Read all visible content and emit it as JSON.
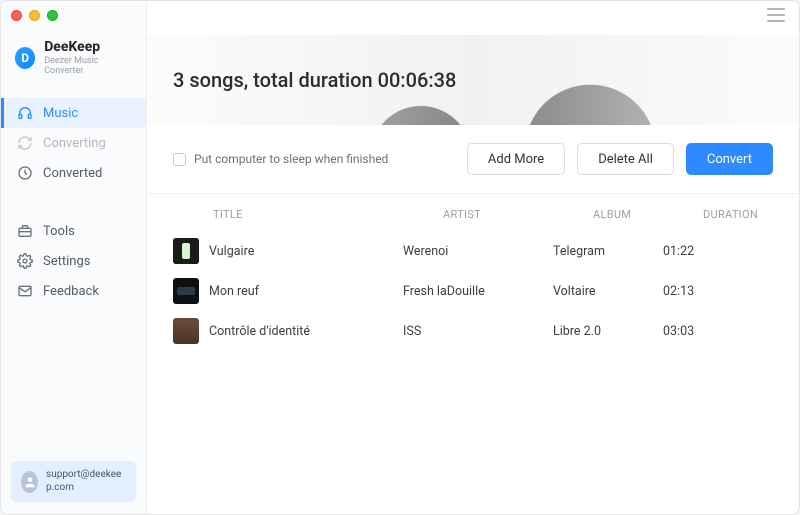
{
  "app": {
    "name": "DeeKeep",
    "subtitle": "Deezer Music Converter"
  },
  "sidebar": {
    "items": [
      {
        "label": "Music",
        "icon": "headphones-icon",
        "active": true,
        "disabled": false
      },
      {
        "label": "Converting",
        "icon": "refresh-icon",
        "active": false,
        "disabled": true
      },
      {
        "label": "Converted",
        "icon": "clock-icon",
        "active": false,
        "disabled": false
      }
    ],
    "items2": [
      {
        "label": "Tools",
        "icon": "toolbox-icon"
      },
      {
        "label": "Settings",
        "icon": "gear-icon"
      },
      {
        "label": "Feedback",
        "icon": "mail-icon"
      }
    ]
  },
  "support": {
    "email": "support@deekeep.com"
  },
  "header": {
    "title": "3 songs, total duration 00:06:38"
  },
  "toolbar": {
    "sleep_label": "Put computer to sleep when finished",
    "add_more": "Add More",
    "delete_all": "Delete All",
    "convert": "Convert"
  },
  "table": {
    "columns": {
      "title": "TITLE",
      "artist": "ARTIST",
      "album": "ALBUM",
      "duration": "DURATION"
    },
    "rows": [
      {
        "title": "Vulgaire",
        "artist": "Werenoi",
        "album": "Telegram",
        "duration": "01:22"
      },
      {
        "title": "Mon reuf",
        "artist": "Fresh laDouille",
        "album": "Voltaire",
        "duration": "02:13"
      },
      {
        "title": "Contrôle d'identité",
        "artist": "ISS",
        "album": "Libre 2.0",
        "duration": "03:03"
      }
    ]
  }
}
